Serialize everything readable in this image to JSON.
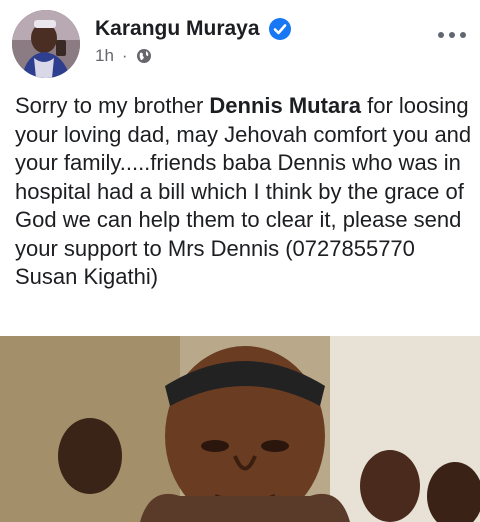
{
  "post": {
    "author_name": "Karangu Muraya",
    "timestamp": "1h",
    "separator": "·",
    "privacy_icon": "globe-icon",
    "verified_icon": "verified-badge-icon",
    "more_icon": "more-options-icon",
    "text_before": "Sorry to my brother ",
    "text_bold": "Dennis Mutara",
    "text_after": " for loosing your loving dad, may Jehovah comfort you and your family.....friends baba Dennis who was in hospital had a bill which I think by the grace of God we can help them to clear it, please send your support to Mrs Dennis (0727855770 Susan Kigathi)"
  },
  "colors": {
    "author_text": "#1c1e21",
    "meta_text": "#65676b",
    "verified_blue": "#1877f2"
  }
}
